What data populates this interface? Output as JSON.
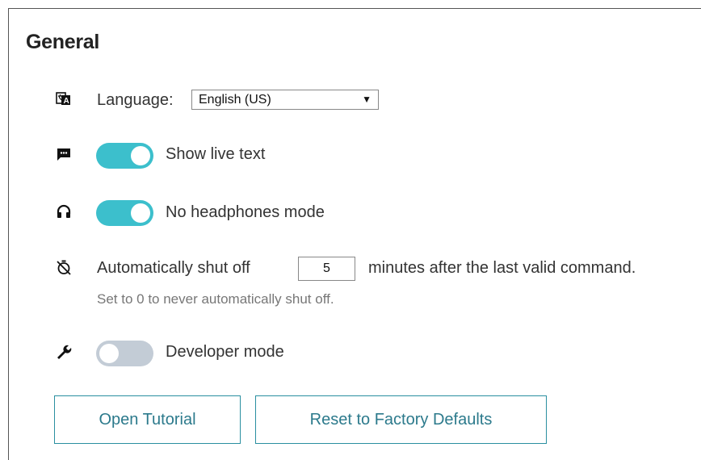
{
  "section": {
    "title": "General"
  },
  "language": {
    "label": "Language:",
    "value": "English (US)",
    "icon": "translate-icon"
  },
  "live_text": {
    "label": "Show live text",
    "enabled": true,
    "icon": "chat-icon"
  },
  "headphones": {
    "label": "No headphones mode",
    "enabled": true,
    "icon": "headphones-icon"
  },
  "shutoff": {
    "label_before": "Automatically shut off",
    "value": "5",
    "label_after": "minutes after the last valid command.",
    "hint": "Set to 0 to never automatically shut off.",
    "icon": "timer-off-icon"
  },
  "developer": {
    "label": "Developer mode",
    "enabled": false,
    "icon": "wrench-icon"
  },
  "buttons": {
    "tutorial": "Open Tutorial",
    "reset": "Reset to Factory Defaults"
  },
  "colors": {
    "accent": "#3cbfcc",
    "toggle_off": "#c3ccd6",
    "button_text": "#2c7a8c"
  }
}
